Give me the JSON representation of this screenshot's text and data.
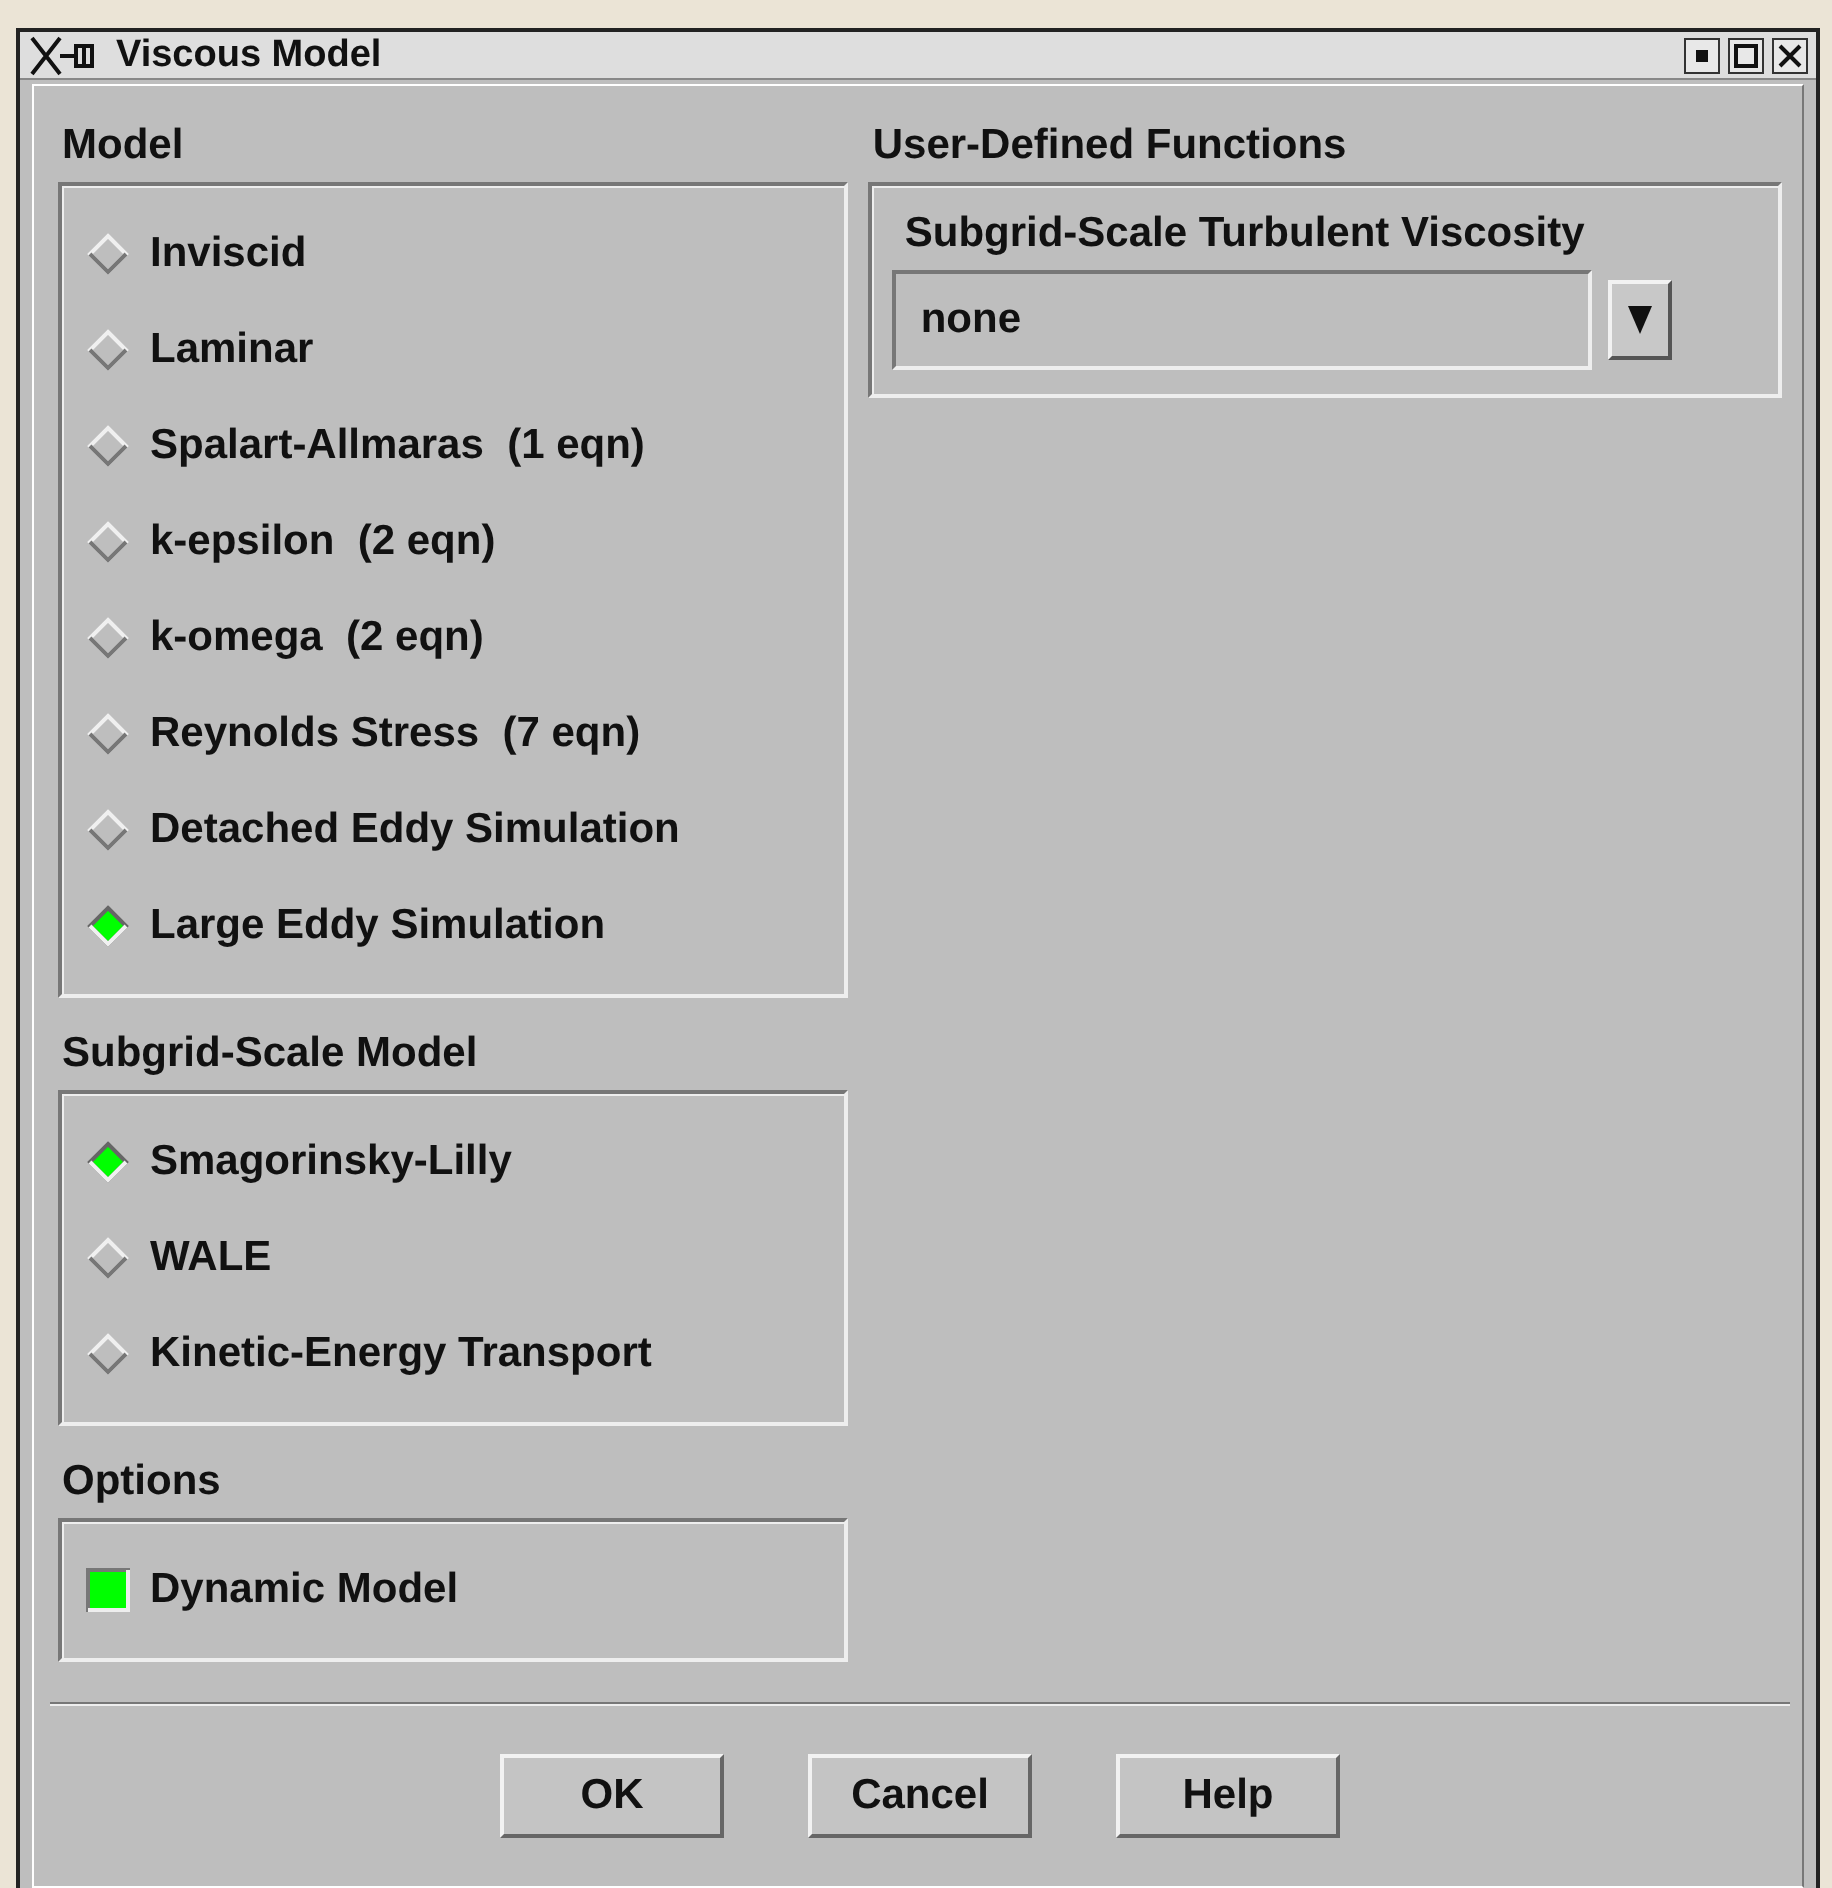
{
  "window": {
    "title": "Viscous Model"
  },
  "model": {
    "label": "Model",
    "options": [
      {
        "label": "Inviscid",
        "selected": false
      },
      {
        "label": "Laminar",
        "selected": false
      },
      {
        "label": "Spalart-Allmaras  (1 eqn)",
        "selected": false
      },
      {
        "label": "k-epsilon  (2 eqn)",
        "selected": false
      },
      {
        "label": "k-omega  (2 eqn)",
        "selected": false
      },
      {
        "label": "Reynolds Stress  (7 eqn)",
        "selected": false
      },
      {
        "label": "Detached Eddy Simulation",
        "selected": false
      },
      {
        "label": "Large Eddy Simulation",
        "selected": true
      }
    ]
  },
  "subgrid_scale_model": {
    "label": "Subgrid-Scale Model",
    "options": [
      {
        "label": "Smagorinsky-Lilly",
        "selected": true
      },
      {
        "label": "WALE",
        "selected": false
      },
      {
        "label": "Kinetic-Energy Transport",
        "selected": false
      }
    ]
  },
  "options": {
    "label": "Options",
    "items": [
      {
        "label": "Dynamic Model",
        "checked": true
      }
    ]
  },
  "user_defined_functions": {
    "label": "User-Defined Functions",
    "field_label": "Subgrid-Scale Turbulent Viscosity",
    "value": "none"
  },
  "buttons": [
    "OK",
    "Cancel",
    "Help"
  ]
}
